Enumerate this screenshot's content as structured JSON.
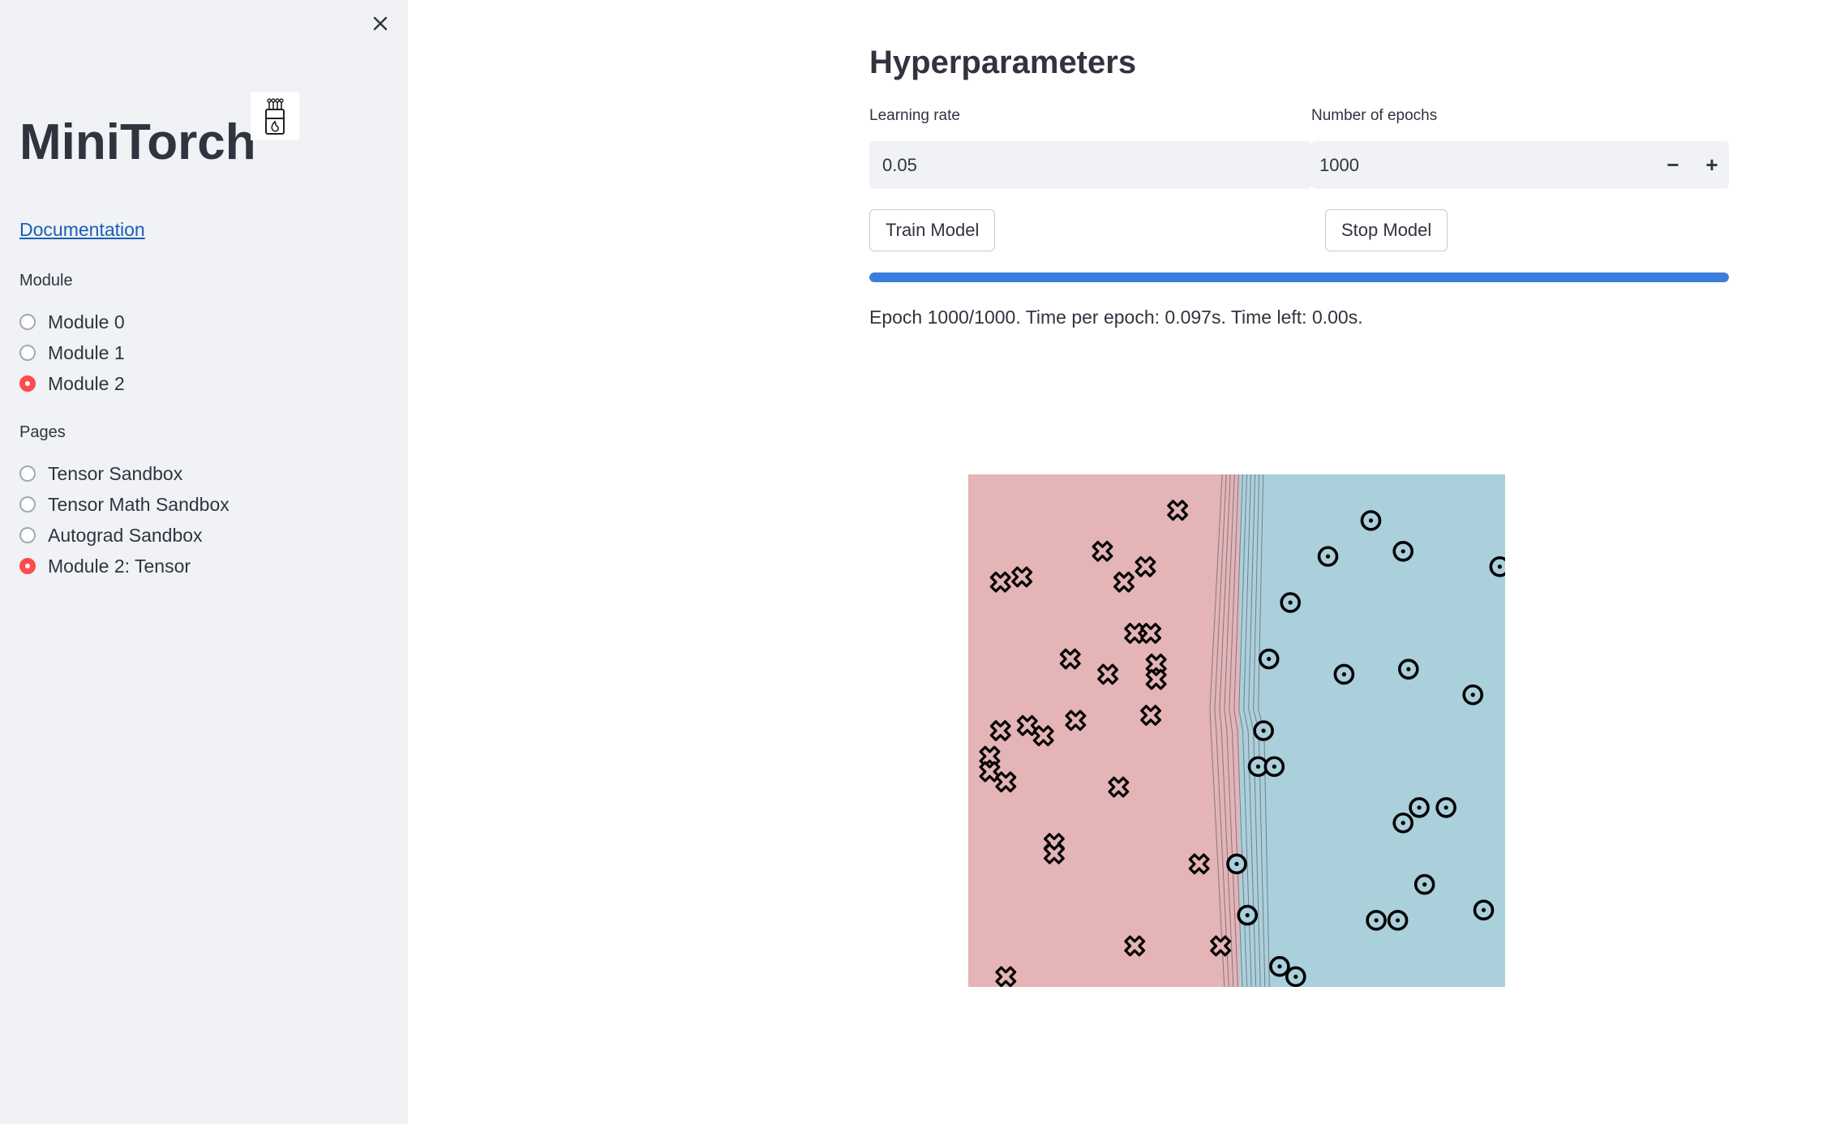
{
  "sidebar": {
    "title": "MiniTorch",
    "doc_link": "Documentation",
    "module_label": "Module",
    "modules": [
      {
        "label": "Module 0",
        "selected": false
      },
      {
        "label": "Module 1",
        "selected": false
      },
      {
        "label": "Module 2",
        "selected": true
      }
    ],
    "pages_label": "Pages",
    "pages": [
      {
        "label": "Tensor Sandbox",
        "selected": false
      },
      {
        "label": "Tensor Math Sandbox",
        "selected": false
      },
      {
        "label": "Autograd Sandbox",
        "selected": false
      },
      {
        "label": "Module 2: Tensor",
        "selected": true
      }
    ]
  },
  "main": {
    "section_title": "Hyperparameters",
    "learning_rate_label": "Learning rate",
    "learning_rate_value": "0.05",
    "epochs_label": "Number of epochs",
    "epochs_value": "1000",
    "stepper_minus": "−",
    "stepper_plus": "+",
    "train_button": "Train Model",
    "stop_button": "Stop Model",
    "progress_percent": 100,
    "status_text": "Epoch 1000/1000. Time per epoch: 0.097s. Time left: 0.00s."
  },
  "colors": {
    "accent": "#ff4b4b",
    "progress": "#3c7ddc",
    "region_class0": "#e4b4b6",
    "region_class1": "#aad0dc",
    "sidebar_bg": "#f0f2f6"
  },
  "chart_data": {
    "type": "scatter",
    "xlim": [
      0,
      1
    ],
    "ylim": [
      0,
      1
    ],
    "decision_boundary_x_range": [
      0.45,
      0.56
    ],
    "series": [
      {
        "marker": "x",
        "points": [
          [
            0.39,
            0.93
          ],
          [
            0.25,
            0.85
          ],
          [
            0.33,
            0.82
          ],
          [
            0.06,
            0.79
          ],
          [
            0.1,
            0.8
          ],
          [
            0.29,
            0.79
          ],
          [
            0.31,
            0.69
          ],
          [
            0.34,
            0.69
          ],
          [
            0.19,
            0.64
          ],
          [
            0.35,
            0.63
          ],
          [
            0.26,
            0.61
          ],
          [
            0.35,
            0.6
          ],
          [
            0.2,
            0.52
          ],
          [
            0.11,
            0.51
          ],
          [
            0.06,
            0.5
          ],
          [
            0.14,
            0.49
          ],
          [
            0.34,
            0.53
          ],
          [
            0.04,
            0.45
          ],
          [
            0.04,
            0.42
          ],
          [
            0.07,
            0.4
          ],
          [
            0.28,
            0.39
          ],
          [
            0.16,
            0.28
          ],
          [
            0.16,
            0.26
          ],
          [
            0.43,
            0.24
          ],
          [
            0.47,
            0.08
          ],
          [
            0.31,
            0.08
          ],
          [
            0.07,
            0.02
          ]
        ]
      },
      {
        "marker": "o",
        "points": [
          [
            0.75,
            0.91
          ],
          [
            0.67,
            0.84
          ],
          [
            0.81,
            0.85
          ],
          [
            0.99,
            0.82
          ],
          [
            0.6,
            0.75
          ],
          [
            0.56,
            0.64
          ],
          [
            0.7,
            0.61
          ],
          [
            0.82,
            0.62
          ],
          [
            0.94,
            0.57
          ],
          [
            0.55,
            0.5
          ],
          [
            0.54,
            0.43
          ],
          [
            0.57,
            0.43
          ],
          [
            0.84,
            0.35
          ],
          [
            0.89,
            0.35
          ],
          [
            0.81,
            0.32
          ],
          [
            0.5,
            0.24
          ],
          [
            0.85,
            0.2
          ],
          [
            0.96,
            0.15
          ],
          [
            0.52,
            0.14
          ],
          [
            0.76,
            0.13
          ],
          [
            0.8,
            0.13
          ],
          [
            0.58,
            0.04
          ],
          [
            0.61,
            0.02
          ]
        ]
      }
    ]
  }
}
